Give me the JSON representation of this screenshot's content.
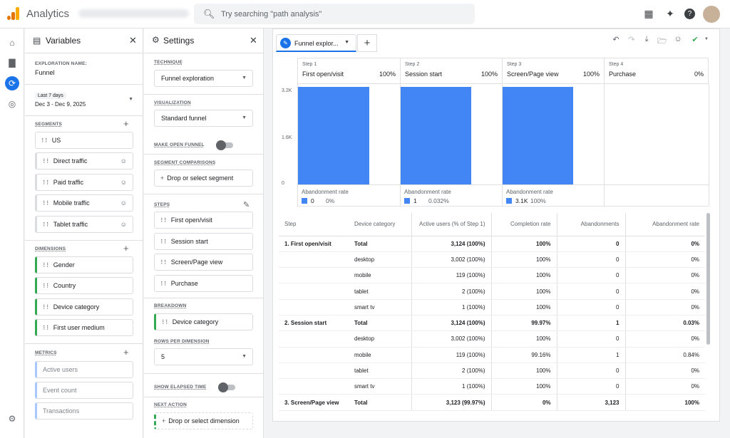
{
  "app": {
    "name": "Analytics"
  },
  "search": {
    "placeholder": "Try searching \"path analysis\""
  },
  "variables": {
    "title": "Variables",
    "exploration_label": "EXPLORATION NAME:",
    "exploration_name": "Funnel",
    "date_range_label": "Last 7 days",
    "date_range": "Dec 3 - Dec 9, 2025",
    "segments_label": "SEGMENTS",
    "segments": [
      "US",
      "Direct traffic",
      "Paid traffic",
      "Mobile traffic",
      "Tablet traffic"
    ],
    "dimensions_label": "DIMENSIONS",
    "dimensions": [
      "Gender",
      "Country",
      "Device category",
      "First user medium"
    ],
    "metrics_label": "METRICS",
    "metrics": [
      "Active users",
      "Event count",
      "Transactions"
    ]
  },
  "settings": {
    "title": "Settings",
    "technique_label": "TECHNIQUE",
    "technique": "Funnel exploration",
    "visualization_label": "VISUALIZATION",
    "visualization": "Standard funnel",
    "open_funnel_label": "MAKE OPEN FUNNEL",
    "segment_comparisons_label": "SEGMENT COMPARISONS",
    "drop_segment": "Drop or select segment",
    "steps_label": "STEPS",
    "steps": [
      "First open/visit",
      "Session start",
      "Screen/Page view",
      "Purchase"
    ],
    "breakdown_label": "BREAKDOWN",
    "breakdown": "Device category",
    "rows_label": "ROWS PER DIMENSION",
    "rows": "5",
    "elapsed_label": "SHOW ELAPSED TIME",
    "next_action_label": "NEXT ACTION",
    "drop_dimension": "Drop or select dimension"
  },
  "tab": {
    "label": "Funnel explor..."
  },
  "chart_data": {
    "type": "bar",
    "categories": [
      "First open/visit",
      "Session start",
      "Screen/Page view",
      "Purchase"
    ],
    "step_numbers": [
      "Step 1",
      "Step 2",
      "Step 3",
      "Step 4"
    ],
    "step_percents": [
      "100%",
      "100%",
      "100%",
      "0%"
    ],
    "values": [
      3124,
      3124,
      3123,
      0
    ],
    "yticks": [
      "3.2K",
      "1.6K",
      "0"
    ],
    "ylim": [
      0,
      3200
    ],
    "abandonment_label": "Abandonment rate",
    "abandonment": [
      {
        "value": "0",
        "pct": "0%"
      },
      {
        "value": "1",
        "pct": "0.032%"
      },
      {
        "value": "3.1K",
        "pct": "100%"
      }
    ]
  },
  "table": {
    "headers": [
      "Step",
      "Device category",
      "Active users (% of Step 1)",
      "Completion rate",
      "Abandonments",
      "Abandonment rate"
    ],
    "rows": [
      [
        "1. First open/visit",
        "Total",
        "3,124 (100%)",
        "100%",
        "0",
        "0%"
      ],
      [
        "",
        "desktop",
        "3,002 (100%)",
        "100%",
        "0",
        "0%"
      ],
      [
        "",
        "mobile",
        "119 (100%)",
        "100%",
        "0",
        "0%"
      ],
      [
        "",
        "tablet",
        "2 (100%)",
        "100%",
        "0",
        "0%"
      ],
      [
        "",
        "smart tv",
        "1 (100%)",
        "100%",
        "0",
        "0%"
      ],
      [
        "2. Session start",
        "Total",
        "3,124 (100%)",
        "99.97%",
        "1",
        "0.03%"
      ],
      [
        "",
        "desktop",
        "3,002 (100%)",
        "100%",
        "0",
        "0%"
      ],
      [
        "",
        "mobile",
        "119 (100%)",
        "99.16%",
        "1",
        "0.84%"
      ],
      [
        "",
        "tablet",
        "2 (100%)",
        "100%",
        "0",
        "0%"
      ],
      [
        "",
        "smart tv",
        "1 (100%)",
        "100%",
        "0",
        "0%"
      ],
      [
        "3. Screen/Page view",
        "Total",
        "3,123 (99.97%)",
        "0%",
        "3,123",
        "100%"
      ]
    ]
  }
}
